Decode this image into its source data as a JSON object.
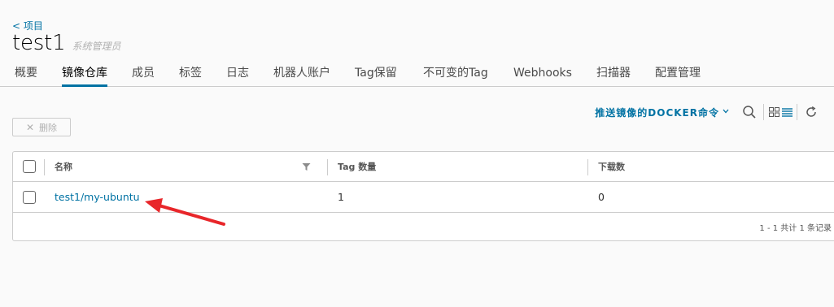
{
  "nav": {
    "back_label": "< 项目"
  },
  "project": {
    "title": "test1",
    "role": "系统管理员"
  },
  "tabs": [
    {
      "label": "概要"
    },
    {
      "label": "镜像仓库",
      "active": true
    },
    {
      "label": "成员"
    },
    {
      "label": "标签"
    },
    {
      "label": "日志"
    },
    {
      "label": "机器人账户"
    },
    {
      "label": "Tag保留"
    },
    {
      "label": "不可变的Tag"
    },
    {
      "label": "Webhooks"
    },
    {
      "label": "扫描器"
    },
    {
      "label": "配置管理"
    }
  ],
  "toolbar": {
    "push_command_label": "推送镜像的DOCKER命令",
    "delete_label": "删除",
    "icons": [
      "search-icon",
      "grid-view-icon",
      "list-view-icon",
      "refresh-icon"
    ]
  },
  "grid": {
    "columns": [
      "名称",
      "Tag 数量",
      "下载数"
    ],
    "rows": [
      {
        "name": "test1/my-ubuntu",
        "tag_count": "1",
        "pulls": "0"
      }
    ],
    "footer": "1 - 1 共计 1 条记录"
  },
  "colors": {
    "accent": "#0072a3",
    "annotation_arrow": "#e8262a"
  }
}
